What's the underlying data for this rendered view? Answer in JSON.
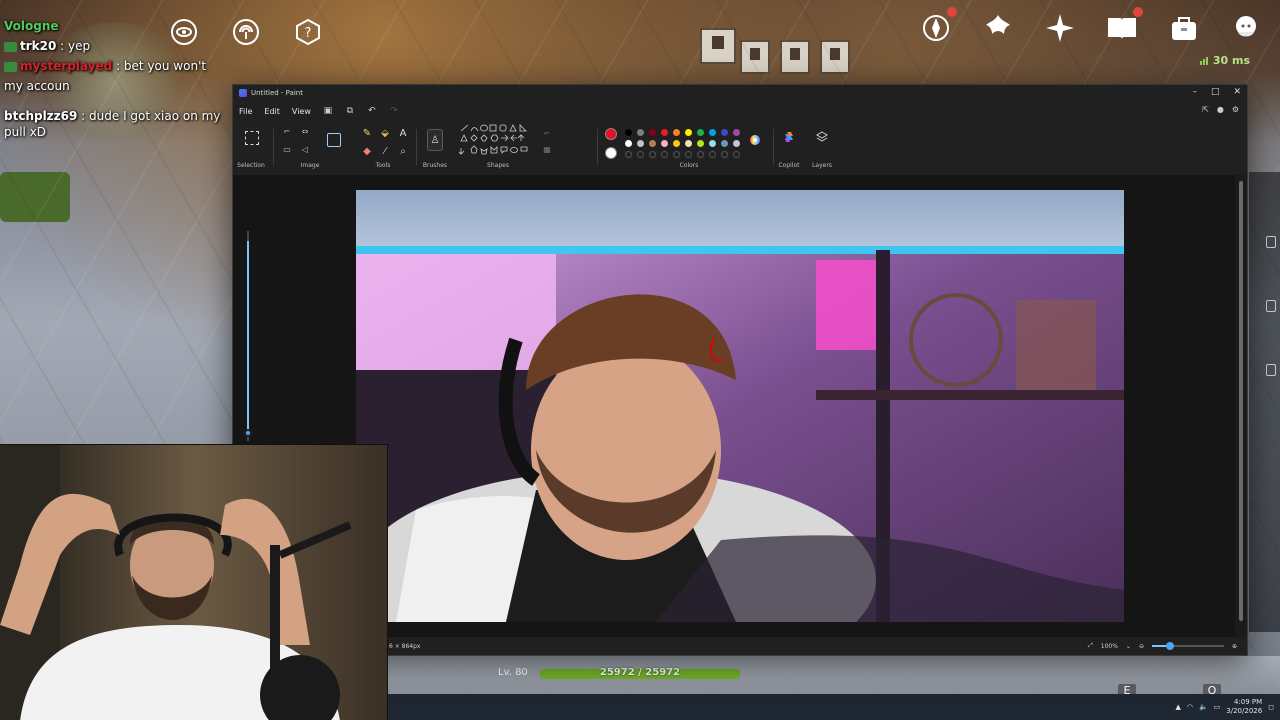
{
  "stream_chat": [
    {
      "user": "Vologne",
      "text": ""
    },
    {
      "user": "trk20",
      "text": "yep"
    },
    {
      "user": "mysterplayed",
      "text": "bet you won't"
    },
    {
      "user": "",
      "text": "my accoun"
    },
    {
      "user": "btchplzz69",
      "text": "dude I got xiao on my pull xD"
    }
  ],
  "game_hud": {
    "ping": "30 ms",
    "level": "Lv. 80",
    "hp_text": "25972 / 25972",
    "hp_fraction": 1.0,
    "key_e": "E",
    "key_q": "Q",
    "top_icons": [
      "compass-icon",
      "wish-icon",
      "sparkle-icon",
      "handbook-icon",
      "quest-bag-icon",
      "paimon-menu-icon"
    ],
    "left_icons": [
      "eye-icon",
      "signal-icon",
      "help-icon"
    ]
  },
  "paint": {
    "window_title": "Untitled - Paint",
    "menu": [
      "File",
      "Edit",
      "View"
    ],
    "groups": {
      "selection": "Selection",
      "image": "Image",
      "tools": "Tools",
      "brushes": "Brushes",
      "shapes": "Shapes",
      "colors": "Colors",
      "copilot": "Copilot",
      "layers": "Layers"
    },
    "palette_row1": [
      "#000000",
      "#7f7f7f",
      "#880015",
      "#ed1c24",
      "#ff7f27",
      "#fff200",
      "#22b14c",
      "#00a2e8",
      "#3f48cc",
      "#a349a4"
    ],
    "palette_row2": [
      "#ffffff",
      "#c3c3c3",
      "#b97a57",
      "#ffaec9",
      "#ffc90e",
      "#efe4b0",
      "#b5e61d",
      "#99d9ea",
      "#7092be",
      "#c8bfe7"
    ],
    "primary_color": "#e81123",
    "secondary_color": "#ffffff",
    "canvas_size": "6 × 864px",
    "zoom": "100%",
    "zoom_fraction": 0.25
  },
  "taskbar": {
    "time": "4:09 PM",
    "date": "3/20/2026"
  }
}
